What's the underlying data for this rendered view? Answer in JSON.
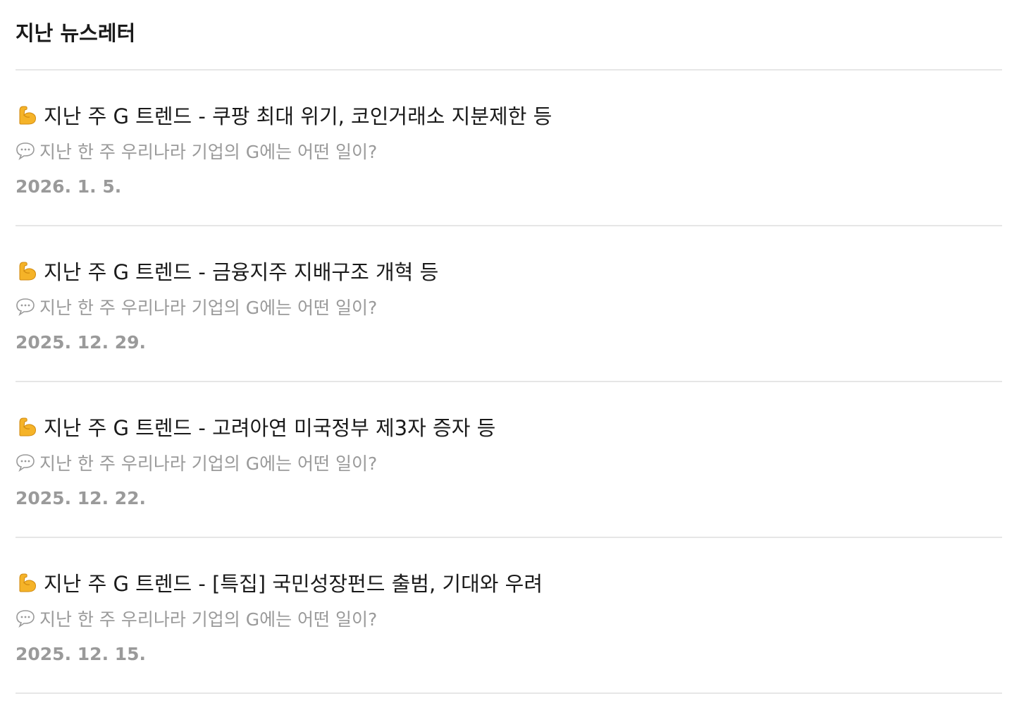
{
  "page": {
    "title": "지난 뉴스레터"
  },
  "posts": [
    {
      "title": "지난 주 G 트렌드 - 쿠팡 최대 위기, 코인거래소 지분제한 등",
      "subtitle": "지난 한 주 우리나라 기업의 G에는 어떤 일이?",
      "date": "2026. 1. 5."
    },
    {
      "title": "지난 주 G 트렌드 - 금융지주 지배구조 개혁 등",
      "subtitle": "지난 한 주 우리나라 기업의 G에는 어떤 일이?",
      "date": "2025. 12. 29."
    },
    {
      "title": "지난 주 G 트렌드 - 고려아연 미국정부 제3자 증자 등",
      "subtitle": "지난 한 주 우리나라 기업의 G에는 어떤 일이?",
      "date": "2025. 12. 22."
    },
    {
      "title": "지난 주 G 트렌드 - [특집] 국민성장펀드 출범, 기대와 우려",
      "subtitle": "지난 한 주 우리나라 기업의 G에는 어떤 일이?",
      "date": "2025. 12. 15."
    }
  ],
  "icons": {
    "title_icon": "flexed-biceps-icon",
    "subtitle_icon": "speech-balloon-icon"
  },
  "colors": {
    "text": "#1a1a1a",
    "muted": "#9a9a9a",
    "divider": "#e6e6e6",
    "emoji": "#f5b328"
  }
}
